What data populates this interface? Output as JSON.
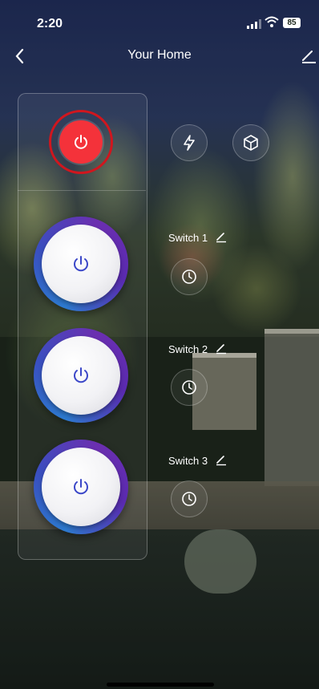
{
  "status_bar": {
    "time": "2:20",
    "battery": "85"
  },
  "nav": {
    "title": "Your Home"
  },
  "master": {
    "state": "on",
    "color": "#f4323a"
  },
  "switches": [
    {
      "label": "Switch 1"
    },
    {
      "label": "Switch 2"
    },
    {
      "label": "Switch 3"
    }
  ],
  "accent_ring": [
    "#2d7bd0",
    "#6b2fb0"
  ]
}
